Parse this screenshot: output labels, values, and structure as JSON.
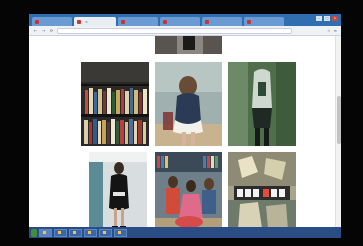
{
  "browser": {
    "tabs": [
      {
        "label": "",
        "active": false
      },
      {
        "label": "",
        "active": true
      },
      {
        "label": "",
        "active": false
      },
      {
        "label": "",
        "active": false
      },
      {
        "label": "",
        "active": false
      },
      {
        "label": "",
        "active": false
      }
    ],
    "close_glyph": "×",
    "url": "",
    "nav": {
      "back": "←",
      "forward": "→",
      "reload": "⟳"
    },
    "window_buttons": {
      "min": "–",
      "max": "□",
      "close": "×"
    }
  },
  "photos": [
    {
      "name": "photo-library-bookshelf"
    },
    {
      "name": "photo-dress-back"
    },
    {
      "name": "photo-green-outfit"
    },
    {
      "name": "photo-black-dress"
    },
    {
      "name": "photo-crowd-event"
    },
    {
      "name": "photo-crafted-hero"
    }
  ],
  "taskbar": {
    "start_label": "",
    "items": [
      {
        "label": ""
      },
      {
        "label": ""
      },
      {
        "label": ""
      },
      {
        "label": ""
      },
      {
        "label": ""
      },
      {
        "label": ""
      }
    ],
    "clock": ""
  },
  "colors": {
    "tab_bar": "#2f6fb0",
    "taskbar": "#2a4d86",
    "start_button": "#3f8f3a"
  }
}
